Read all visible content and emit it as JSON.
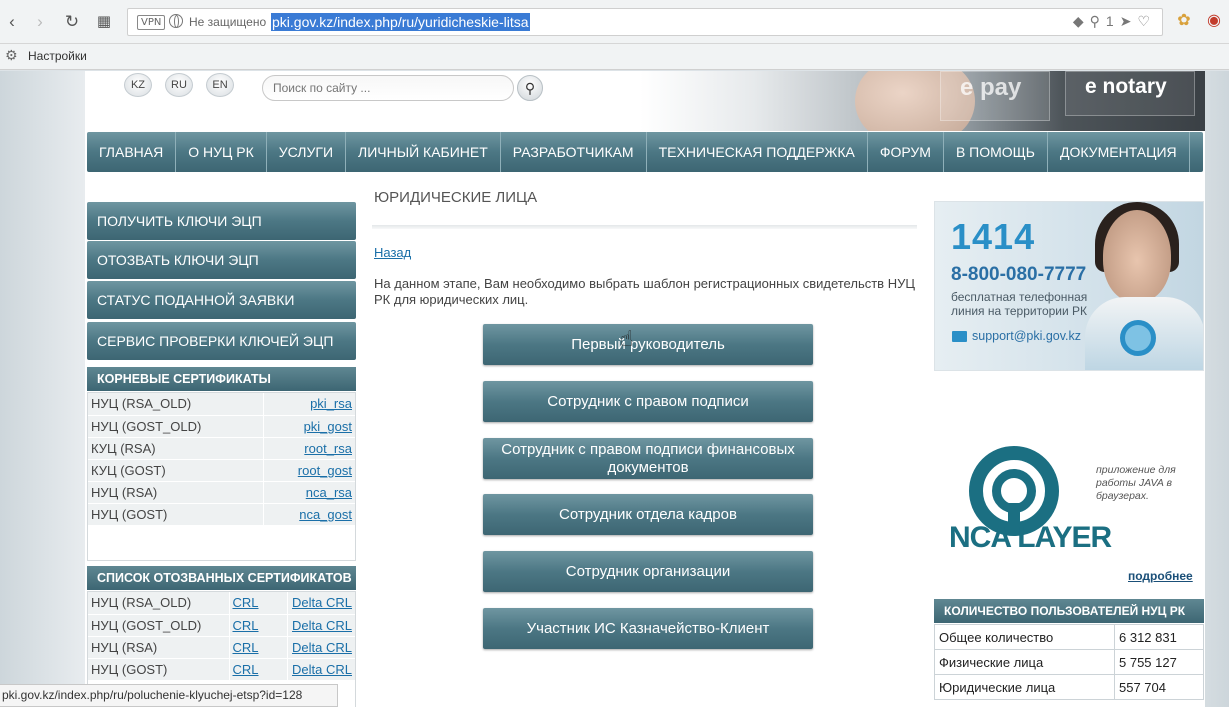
{
  "browser": {
    "vpn": "VPN",
    "security": "Не защищено",
    "url": "pki.gov.kz/index.php/ru/yuridicheskie-litsa",
    "tab_count": "1",
    "bookmark": "Настройки"
  },
  "header": {
    "langs": [
      "KZ",
      "RU",
      "EN"
    ],
    "search_placeholder": "Поиск по сайту ...",
    "banner_epay": "e pay",
    "banner_enotary": "e notary"
  },
  "mainnav": [
    "Главная",
    "О НУЦ РК",
    "Услуги",
    "Личный кабинет",
    "Разработчикам",
    "Техническая поддержка",
    "Форум",
    "В помощь",
    "Документация"
  ],
  "left": {
    "buttons": [
      "Получить ключи ЭЦП",
      "Отозвать ключи ЭЦП",
      "Статус поданной заявки",
      "Сервис проверки ключей ЭЦП"
    ],
    "root_title": "Корневые сертификаты",
    "root_rows": [
      {
        "name": "НУЦ (RSA_OLD)",
        "link": "pki_rsa"
      },
      {
        "name": "НУЦ (GOST_OLD)",
        "link": "pki_gost"
      },
      {
        "name": "КУЦ (RSA)",
        "link": "root_rsa"
      },
      {
        "name": "КУЦ (GOST)",
        "link": "root_gost"
      },
      {
        "name": "НУЦ (RSA)",
        "link": "nca_rsa"
      },
      {
        "name": "НУЦ (GOST)",
        "link": "nca_gost"
      }
    ],
    "crl_title": "Список отозванных сертификатов",
    "crl_rows": [
      {
        "name": "НУЦ (RSA_OLD)",
        "crl": "CRL",
        "delta": "Delta CRL"
      },
      {
        "name": "НУЦ (GOST_OLD)",
        "crl": "CRL",
        "delta": "Delta CRL"
      },
      {
        "name": "НУЦ (RSA)",
        "crl": "CRL",
        "delta": "Delta CRL"
      },
      {
        "name": "НУЦ (GOST)",
        "crl": "CRL",
        "delta": "Delta CRL"
      }
    ]
  },
  "main": {
    "title": "Юридические лица",
    "back": "Назад",
    "intro": "На данном этапе, Вам необходимо выбрать шаблон регистрационных свидетельств НУЦ РК для юридических лиц.",
    "templates": [
      "Первый руководитель",
      "Сотрудник с правом подписи",
      "Сотрудник с правом подписи финансовых документов",
      "Сотрудник отдела кадров",
      "Сотрудник организации",
      "Участник ИС Казначейство-Клиент"
    ]
  },
  "right": {
    "ad_short": "1414",
    "ad_phone": "8-800-080-7777",
    "ad_free": "бесплатная телефонная линия на территории РК",
    "ad_email": "support@pki.gov.kz",
    "nca_logo_a": "NCA",
    "nca_logo_b": "LAYER",
    "nca_note": "приложение для работы JAVA в браузерах.",
    "more": "подробнее",
    "stats_title": "Количество пользователей НУЦ РК",
    "stats": [
      {
        "label": "Общее количество",
        "value": "6 312 831"
      },
      {
        "label": "Физические лица",
        "value": "5 755 127"
      },
      {
        "label": "Юридические лица",
        "value": "557 704"
      }
    ]
  },
  "status_url": "pki.gov.kz/index.php/ru/poluchenie-klyuchej-etsp?id=128",
  "colors": {
    "nav": "#4c7784",
    "link": "#1a6fa8",
    "accent": "#2a8fc7"
  }
}
